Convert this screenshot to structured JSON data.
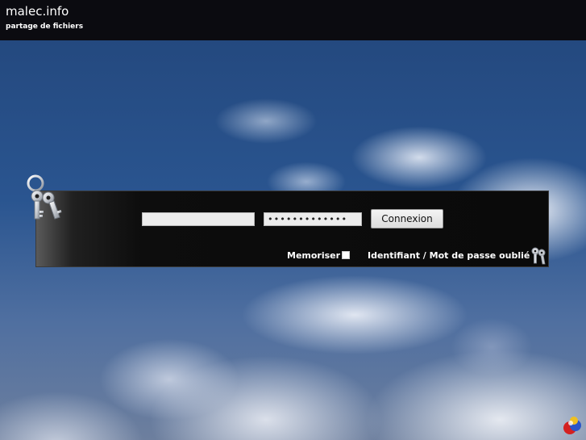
{
  "header": {
    "title": "malec.info",
    "subtitle": "partage de fichiers"
  },
  "login": {
    "username_value": "",
    "password_value": "•••••••••••••",
    "connect_label": "Connexion",
    "remember_label": "Memoriser",
    "remember_checked": false,
    "forgot_label": "Identifiant / Mot de passe oublié ?"
  },
  "icons": {
    "keys": "keys-icon",
    "forgot": "keys-small-icon",
    "corner": "logo-icon"
  },
  "colors": {
    "header_bg": "#0b0b10",
    "panel_bg": "#0a0a0a",
    "sky": "#2a5590"
  }
}
